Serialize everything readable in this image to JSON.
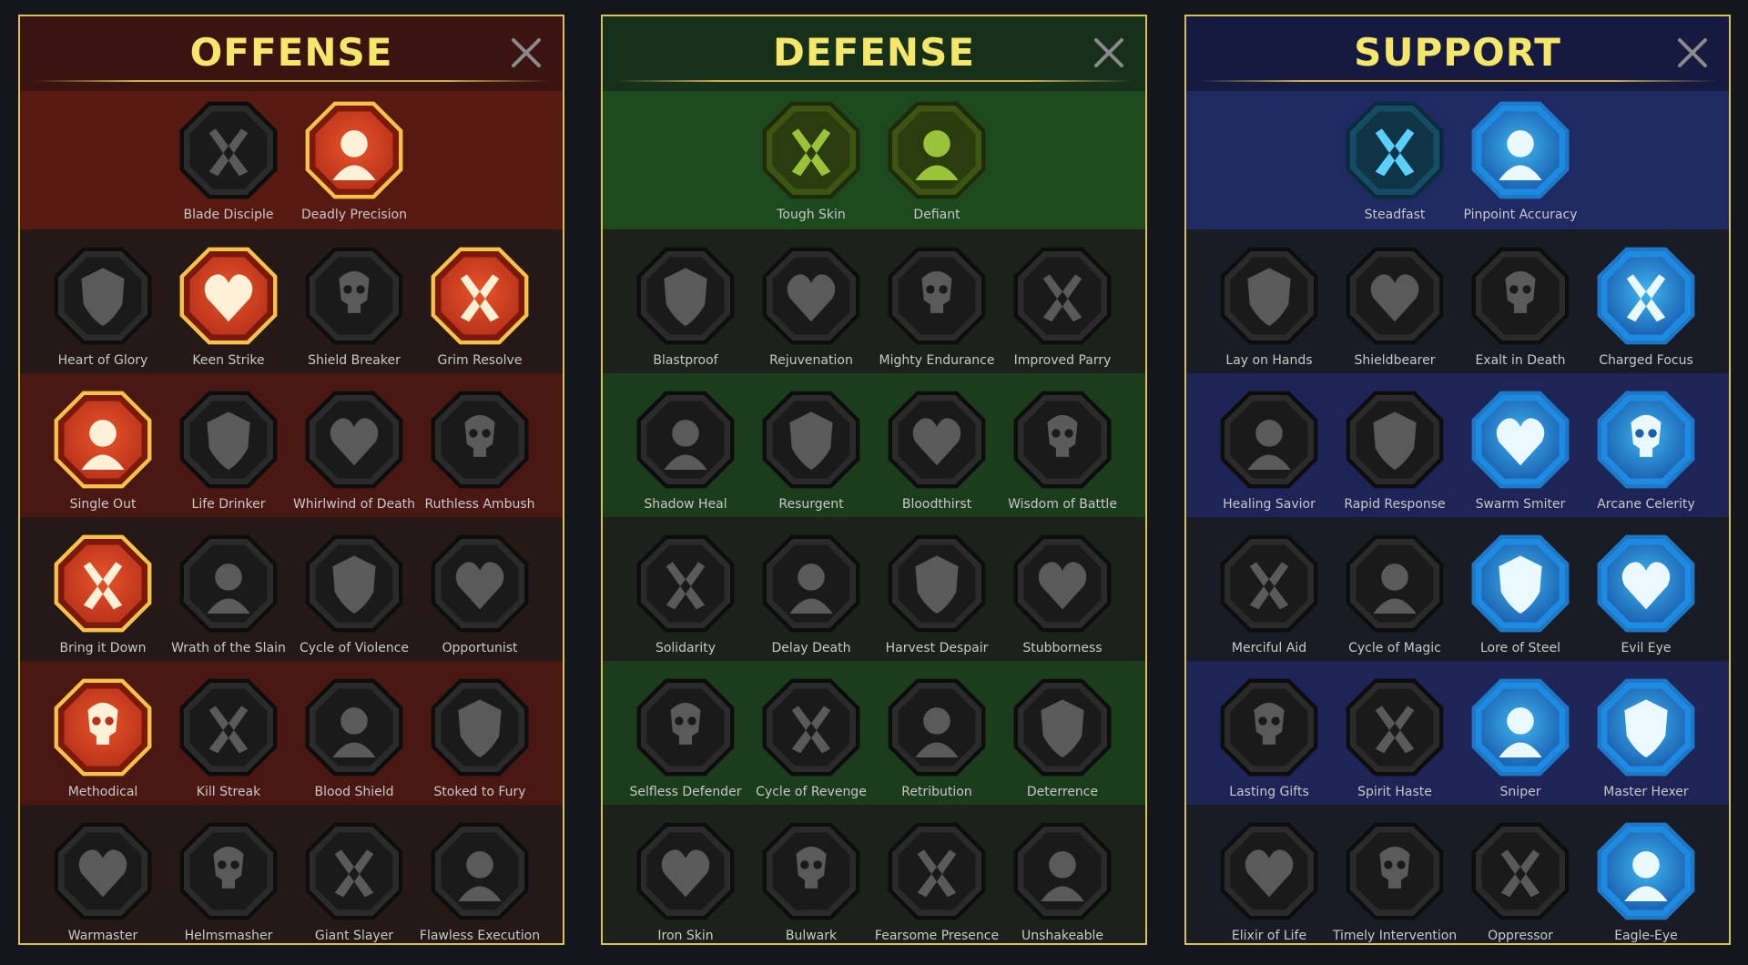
{
  "colors": {
    "title_yellow": "#f4e76a",
    "panel_border": "#d8c05a",
    "inactive_icon_fill": "#4a4a4a",
    "inactive_frame": "#1c1c1c",
    "offense_active_fill": "#e8542a",
    "offense_active_rim": "#f6c24a",
    "defense_active_fill": "#6f9a1d",
    "defense_active_rim": "#2f3f12",
    "support_active_fill": "#3fb6f0",
    "support_active_rim": "#1d78c8"
  },
  "panels": [
    {
      "id": "offense",
      "title": "OFFENSE",
      "close_icon": "close-x-icon",
      "rows": [
        [
          {
            "label": "Blade Disciple",
            "icon": "crossed-swords-icon",
            "state": "inactive"
          },
          {
            "label": "Deadly Precision",
            "icon": "piercing-dagger-icon",
            "state": "active"
          }
        ],
        [
          {
            "label": "Heart of Glory",
            "icon": "horned-heart-icon",
            "state": "inactive"
          },
          {
            "label": "Keen Strike",
            "icon": "sword-burst-icon",
            "state": "active"
          },
          {
            "label": "Shield Breaker",
            "icon": "broken-shield-icon",
            "state": "inactive"
          },
          {
            "label": "Grim Resolve",
            "icon": "bleeding-heart-icon",
            "state": "active"
          }
        ],
        [
          {
            "label": "Single Out",
            "icon": "arrows-hit-icon",
            "state": "active"
          },
          {
            "label": "Life Drinker",
            "icon": "fangs-icon",
            "state": "inactive"
          },
          {
            "label": "Whirlwind of Death",
            "icon": "skull-whirl-icon",
            "state": "inactive"
          },
          {
            "label": "Ruthless Ambush",
            "icon": "dagger-hand-icon",
            "state": "inactive"
          }
        ],
        [
          {
            "label": "Bring it Down",
            "icon": "sword-heart-icon",
            "state": "active"
          },
          {
            "label": "Wrath of the Slain",
            "icon": "fist-hammer-icon",
            "state": "inactive"
          },
          {
            "label": "Cycle of Violence",
            "icon": "axe-cycle-icon",
            "state": "inactive"
          },
          {
            "label": "Opportunist",
            "icon": "broken-chain-icon",
            "state": "inactive"
          }
        ],
        [
          {
            "label": "Methodical",
            "icon": "arrows-target-icon",
            "state": "active"
          },
          {
            "label": "Kill Streak",
            "icon": "skulls-icon",
            "state": "inactive"
          },
          {
            "label": "Blood Shield",
            "icon": "sword-shield-icon",
            "state": "inactive"
          },
          {
            "label": "Stoked to Fury",
            "icon": "raging-figure-icon",
            "state": "inactive"
          }
        ],
        [
          {
            "label": "Warmaster",
            "icon": "sparkling-sword-icon",
            "state": "inactive"
          },
          {
            "label": "Helmsmasher",
            "icon": "cracked-helm-icon",
            "state": "inactive"
          },
          {
            "label": "Giant Slayer",
            "icon": "giant-icon",
            "state": "inactive"
          },
          {
            "label": "Flawless Execution",
            "icon": "skull-blade-icon",
            "state": "inactive"
          }
        ]
      ]
    },
    {
      "id": "defense",
      "title": "DEFENSE",
      "close_icon": "close-x-icon",
      "rows": [
        [
          {
            "label": "Tough Skin",
            "icon": "scales-armor-icon",
            "state": "active"
          },
          {
            "label": "Defiant",
            "icon": "raised-fist-icon",
            "state": "active"
          }
        ],
        [
          {
            "label": "Blastproof",
            "icon": "chevron-shield-icon",
            "state": "inactive"
          },
          {
            "label": "Rejuvenation",
            "icon": "heart-organ-icon",
            "state": "inactive"
          },
          {
            "label": "Mighty Endurance",
            "icon": "armored-warrior-icon",
            "state": "inactive"
          },
          {
            "label": "Improved Parry",
            "icon": "crossed-blades-icon",
            "state": "inactive"
          }
        ],
        [
          {
            "label": "Shadow Heal",
            "icon": "shadow-figure-icon",
            "state": "inactive"
          },
          {
            "label": "Resurgent",
            "icon": "knight-shield-icon",
            "state": "inactive"
          },
          {
            "label": "Bloodthirst",
            "icon": "skull-heart-icon",
            "state": "inactive"
          },
          {
            "label": "Wisdom of Battle",
            "icon": "sage-head-icon",
            "state": "inactive"
          }
        ],
        [
          {
            "label": "Solidarity",
            "icon": "group-figures-icon",
            "state": "inactive"
          },
          {
            "label": "Delay Death",
            "icon": "hourglass-icon",
            "state": "inactive"
          },
          {
            "label": "Harvest Despair",
            "icon": "open-hand-icon",
            "state": "inactive"
          },
          {
            "label": "Stubborness",
            "icon": "bull-head-icon",
            "state": "inactive"
          }
        ],
        [
          {
            "label": "Selfless Defender",
            "icon": "running-defender-icon",
            "state": "inactive"
          },
          {
            "label": "Cycle of Revenge",
            "icon": "blood-drops-icon",
            "state": "inactive"
          },
          {
            "label": "Retribution",
            "icon": "spiked-skull-icon",
            "state": "inactive"
          },
          {
            "label": "Deterrence",
            "icon": "reaching-hand-icon",
            "state": "inactive"
          }
        ],
        [
          {
            "label": "Iron Skin",
            "icon": "crowned-beast-icon",
            "state": "inactive"
          },
          {
            "label": "Bulwark",
            "icon": "winged-shield-icon",
            "state": "inactive"
          },
          {
            "label": "Fearsome Presence",
            "icon": "dark-skull-icon",
            "state": "inactive"
          },
          {
            "label": "Unshakeable",
            "icon": "flexing-figure-icon",
            "state": "inactive"
          }
        ]
      ]
    },
    {
      "id": "support",
      "title": "SUPPORT",
      "close_icon": "close-x-icon",
      "rows": [
        [
          {
            "label": "Steadfast",
            "icon": "heart-plus-icon",
            "state": "active-dark"
          },
          {
            "label": "Pinpoint Accuracy",
            "icon": "target-burst-icon",
            "state": "active"
          }
        ],
        [
          {
            "label": "Lay on Hands",
            "icon": "praying-hands-icon",
            "state": "inactive"
          },
          {
            "label": "Shieldbearer",
            "icon": "radiant-shield-icon",
            "state": "inactive"
          },
          {
            "label": "Exalt in Death",
            "icon": "flaming-skull-icon",
            "state": "inactive"
          },
          {
            "label": "Charged Focus",
            "icon": "charged-wings-icon",
            "state": "active"
          }
        ],
        [
          {
            "label": "Healing Savior",
            "icon": "blessed-figure-icon",
            "state": "inactive"
          },
          {
            "label": "Rapid Response",
            "icon": "lightning-icon",
            "state": "inactive"
          },
          {
            "label": "Swarm Smiter",
            "icon": "zigzag-bolts-icon",
            "state": "active"
          },
          {
            "label": "Arcane Celerity",
            "icon": "speed-figure-icon",
            "state": "active"
          }
        ],
        [
          {
            "label": "Merciful Aid",
            "icon": "chained-heart-icon",
            "state": "inactive"
          },
          {
            "label": "Cycle of Magic",
            "icon": "comet-cycle-icon",
            "state": "inactive"
          },
          {
            "label": "Lore of Steel",
            "icon": "open-book-icon",
            "state": "active"
          },
          {
            "label": "Evil Eye",
            "icon": "glaring-eyes-icon",
            "state": "active"
          }
        ],
        [
          {
            "label": "Lasting Gifts",
            "icon": "compass-star-icon",
            "state": "inactive"
          },
          {
            "label": "Spirit Haste",
            "icon": "swift-boot-icon",
            "state": "inactive"
          },
          {
            "label": "Sniper",
            "icon": "eye-icon",
            "state": "active"
          },
          {
            "label": "Master Hexer",
            "icon": "voodoo-doll-icon",
            "state": "active"
          }
        ],
        [
          {
            "label": "Elixir of Life",
            "icon": "potion-icon",
            "state": "inactive"
          },
          {
            "label": "Timely Intervention",
            "icon": "screaming-skull-icon",
            "state": "inactive"
          },
          {
            "label": "Oppressor",
            "icon": "crushing-fist-icon",
            "state": "inactive"
          },
          {
            "label": "Eagle-Eye",
            "icon": "eagle-head-icon",
            "state": "active"
          }
        ]
      ]
    }
  ]
}
